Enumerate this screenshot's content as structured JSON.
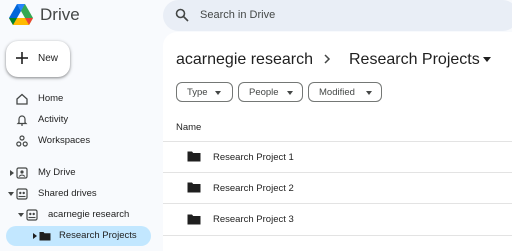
{
  "app": {
    "title": "Drive"
  },
  "search": {
    "placeholder": "Search in Drive"
  },
  "new_button": {
    "label": "New"
  },
  "nav": {
    "home": "Home",
    "activity": "Activity",
    "workspaces": "Workspaces",
    "my_drive": "My Drive",
    "shared_drives": "Shared drives",
    "acarnegie_research": "acarnegie research",
    "research_projects": "Research Projects"
  },
  "breadcrumb": {
    "root": "acarnegie research",
    "current": "Research Projects"
  },
  "filters": {
    "type": "Type",
    "people": "People",
    "modified": "Modified"
  },
  "table": {
    "column_name": "Name",
    "rows": [
      {
        "name": "Research Project 1"
      },
      {
        "name": "Research Project 2"
      },
      {
        "name": "Research Project 3"
      }
    ]
  },
  "colors": {
    "active_nav": "#c2e7ff",
    "search_bg": "#e9eef6",
    "page_bg": "#f8fafd"
  },
  "icons": [
    "drive-logo",
    "search-icon",
    "plus-icon",
    "home-icon",
    "bell-icon",
    "workspaces-icon",
    "my-drive-icon",
    "shared-drives-icon",
    "folder-icon"
  ]
}
